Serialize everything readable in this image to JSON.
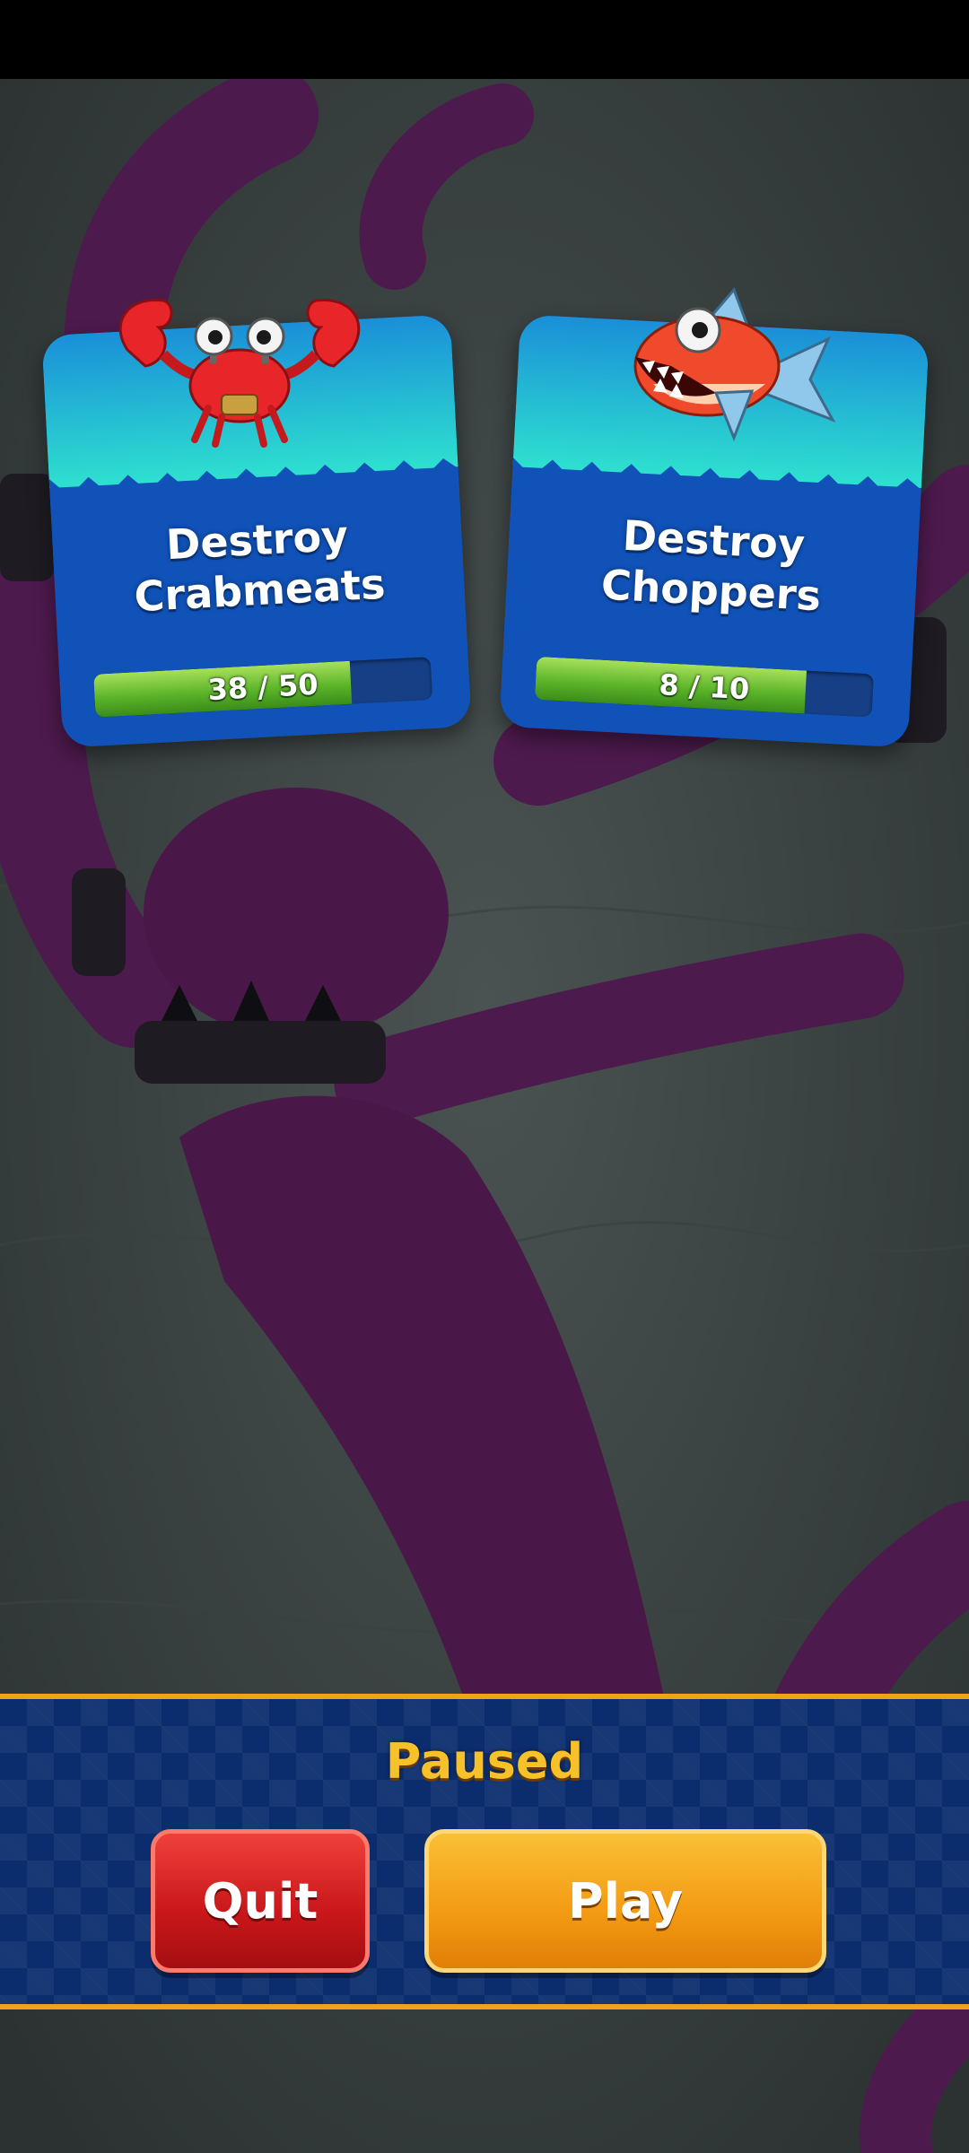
{
  "missions": [
    {
      "title": "Destroy\nCrabmeats",
      "progress_text": "38 / 50",
      "progress": 0.76,
      "enemy_icon": "crabmeat-icon"
    },
    {
      "title": "Destroy\nChoppers",
      "progress_text": "8 / 10",
      "progress": 0.8,
      "enemy_icon": "chopper-icon"
    }
  ],
  "pause_menu": {
    "title": "Paused",
    "quit_label": "Quit",
    "play_label": "Play"
  },
  "colors": {
    "card_top": "#1bb4d8",
    "card_bottom": "#1052b8",
    "progress_green": "#5cb52a",
    "panel_blue": "#0b2d6e",
    "panel_border": "#f2a21a",
    "title_gold": "#f7c12a",
    "quit_red": "#c8161a",
    "play_orange": "#f39a12"
  }
}
